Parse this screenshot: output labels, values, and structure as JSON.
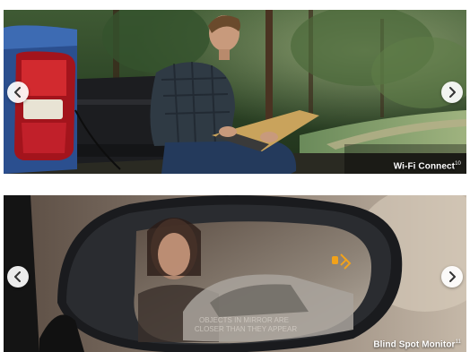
{
  "slides": [
    {
      "caption": "Wi-Fi Connect",
      "footnote": "10",
      "prev_icon": "chevron-left-icon",
      "next_icon": "chevron-right-icon"
    },
    {
      "caption": "Blind Spot Monitor",
      "footnote": "11",
      "mirror_text_line1": "OBJECTS IN MIRROR ARE",
      "mirror_text_line2": "CLOSER THAN THEY APPEAR",
      "mirror_indicator": "BSM",
      "prev_icon": "chevron-left-icon",
      "next_icon": "chevron-right-icon"
    }
  ],
  "colors": {
    "caption": "#ffffff",
    "nav_bg": "#ffffff",
    "nav_arrow": "#333333",
    "bsm_indicator": "#f2a21a"
  }
}
